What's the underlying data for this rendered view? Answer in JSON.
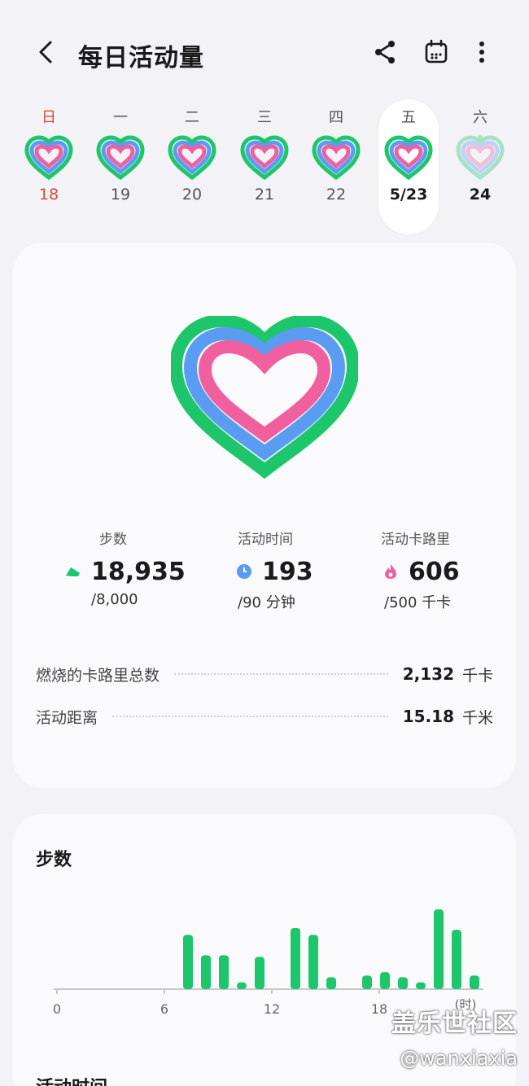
{
  "header": {
    "title": "每日活动量",
    "icons": [
      "back-arrow-icon",
      "share-icon",
      "calendar-icon",
      "more-vert-icon"
    ]
  },
  "week": {
    "days": [
      {
        "weekday": "日",
        "date": "18"
      },
      {
        "weekday": "一",
        "date": "19"
      },
      {
        "weekday": "二",
        "date": "20"
      },
      {
        "weekday": "三",
        "date": "21"
      },
      {
        "weekday": "四",
        "date": "22"
      },
      {
        "weekday": "五",
        "date": "5/23"
      },
      {
        "weekday": "六",
        "date": "24"
      }
    ]
  },
  "summary": {
    "steps": {
      "label": "步数",
      "value": "18,935",
      "goal": "/8,000"
    },
    "active_time": {
      "label": "活动时间",
      "value": "193",
      "goal": "/90 分钟"
    },
    "active_cal": {
      "label": "活动卡路里",
      "value": "606",
      "goal": "/500 千卡"
    },
    "total_burned": {
      "label": "燃烧的卡路里总数",
      "value": "2,132",
      "unit": "千卡"
    },
    "distance": {
      "label": "活动距离",
      "value": "15.18",
      "unit": "千米"
    }
  },
  "colors": {
    "green": "#1ec66b",
    "blue": "#5a9cf2",
    "pink": "#f0609e",
    "sunday": "#d74a3a"
  },
  "steps_chart": {
    "title": "步数",
    "chart_data": {
      "type": "bar",
      "title": "步数",
      "xlabel": "(时)",
      "x_ticks": [
        "0",
        "6",
        "12",
        "18"
      ],
      "categories": [
        0,
        1,
        2,
        3,
        4,
        5,
        6,
        7,
        8,
        9,
        10,
        11,
        12,
        13,
        14,
        15,
        16,
        17,
        18,
        19,
        20,
        21,
        22,
        23
      ],
      "values": [
        0,
        0,
        0,
        0,
        0,
        0,
        0,
        1600,
        1000,
        1000,
        200,
        950,
        0,
        1800,
        1600,
        350,
        0,
        400,
        500,
        350,
        200,
        2350,
        1750,
        400
      ]
    }
  },
  "next_section": {
    "title": "活动时间"
  },
  "watermark": {
    "line1": "盖乐世社区",
    "line2": "@wanxiaxia"
  }
}
